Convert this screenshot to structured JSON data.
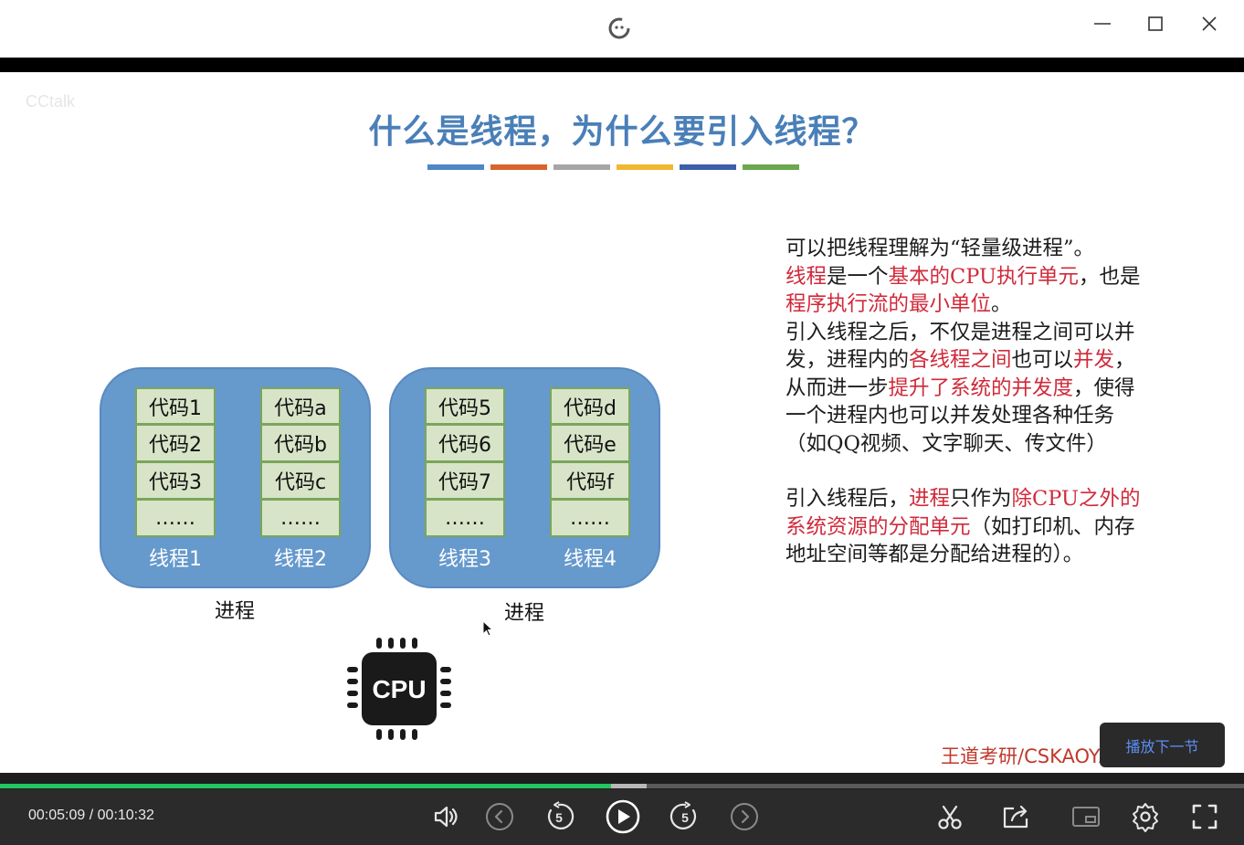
{
  "slide": {
    "watermark": "CCtalk",
    "title": "什么是线程，为什么要引入线程？",
    "title_bar_colors": [
      "#4f86c6",
      "#d9642e",
      "#a6a6a6",
      "#f2b630",
      "#3d5eab",
      "#6aa84f"
    ],
    "processes": [
      {
        "label": "进程",
        "threads": [
          {
            "label": "线程1",
            "cells": [
              "代码1",
              "代码2",
              "代码3",
              "……"
            ]
          },
          {
            "label": "线程2",
            "cells": [
              "代码a",
              "代码b",
              "代码c",
              "……"
            ]
          }
        ]
      },
      {
        "label": "进程",
        "threads": [
          {
            "label": "线程3",
            "cells": [
              "代码5",
              "代码6",
              "代码7",
              "……"
            ]
          },
          {
            "label": "线程4",
            "cells": [
              "代码d",
              "代码e",
              "代码f",
              "……"
            ]
          }
        ]
      }
    ],
    "cpu_label": "CPU",
    "description": {
      "p1": "可以把线程理解为“轻量级进程”。",
      "p2_a": "线程",
      "p2_b": "是一个",
      "p2_c": "基本的CPU执行单元",
      "p2_d": "，",
      "p2_e": "也是",
      "p2_f": "程序执行流的最小单位",
      "p2_g": "。",
      "p3_a": "引入线程之后，不仅是进程之间可以并发，进程内的",
      "p3_b": "各线程之间",
      "p3_c": "也可以",
      "p3_d": "并发",
      "p3_e": "，从而进一步",
      "p3_f": "提升了系统的并发度",
      "p3_g": "，使得一个进程内也可以并发处理各种任务（如QQ视频、文字聊天、传文件）",
      "p4_a": "引入线程后，",
      "p4_b": "进程",
      "p4_c": "只作为",
      "p4_d": "除CPU之外的系统资源的分配单元",
      "p4_e": "（如打印机、内存地址空间等都是分配给进程的）。"
    },
    "brand": "王道考研/CSKAOYAN.COM"
  },
  "next_button": {
    "label": "播放下一节"
  },
  "player": {
    "current_time": "00:05:09",
    "separator": "/",
    "total_time": "00:10:32",
    "progress": 0.491,
    "buffered": 0.52,
    "rewind_seconds": "5",
    "forward_seconds": "5",
    "accent_color": "#22c55e"
  }
}
